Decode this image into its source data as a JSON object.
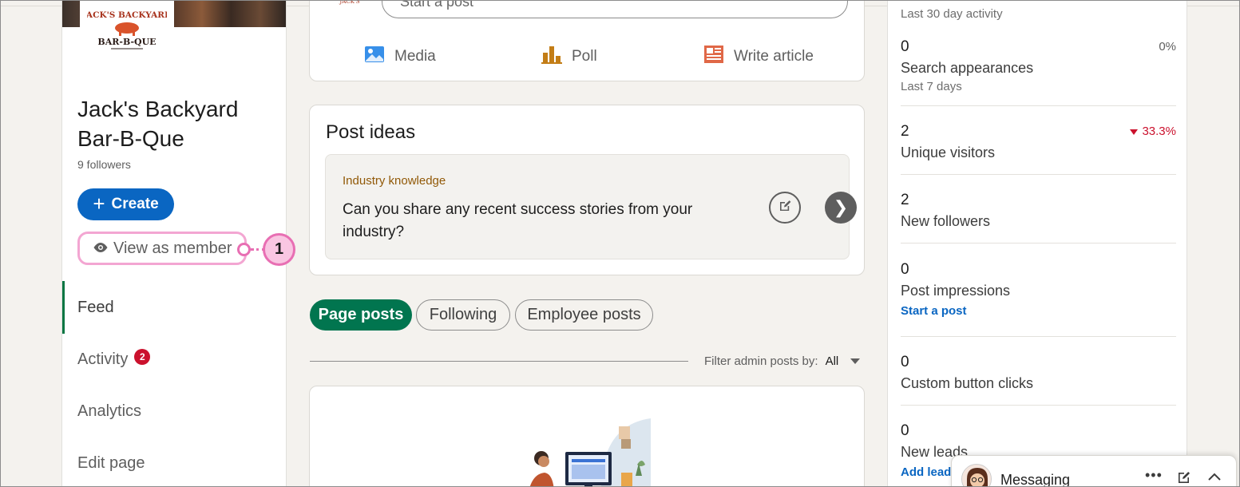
{
  "company": {
    "name": "Jack's Backyard Bar-B-Que",
    "followers": "9 followers",
    "logo_text_top": "JACK'S BACKYARD",
    "logo_text_bottom": "BAR-B-QUE"
  },
  "left": {
    "create_label": "Create",
    "view_member_label": "View as member",
    "nav": [
      {
        "label": "Feed",
        "active": true
      },
      {
        "label": "Activity",
        "badge": "2"
      },
      {
        "label": "Analytics"
      },
      {
        "label": "Edit page"
      }
    ]
  },
  "annotation": {
    "number": "1"
  },
  "compose": {
    "placeholder": "Start a post",
    "actions": [
      {
        "label": "Media",
        "icon": "media-icon"
      },
      {
        "label": "Poll",
        "icon": "poll-icon"
      },
      {
        "label": "Write article",
        "icon": "article-icon"
      }
    ]
  },
  "ideas": {
    "title": "Post ideas",
    "category": "Industry knowledge",
    "text": "Can you share any recent success stories from your industry?"
  },
  "feed_tabs": [
    "Page posts",
    "Following",
    "Employee posts"
  ],
  "filter": {
    "label": "Filter admin posts by:",
    "value": "All"
  },
  "analytics": {
    "subtitle": "Last 30 day activity",
    "stats": [
      {
        "num": "0",
        "label": "Search appearances",
        "sub": "Last 7 days",
        "pct": "0%"
      },
      {
        "num": "2",
        "label": "Unique visitors",
        "pct": "33.3%",
        "trend": "down"
      },
      {
        "num": "2",
        "label": "New followers"
      },
      {
        "num": "0",
        "label": "Post impressions",
        "link": "Start a post"
      },
      {
        "num": "0",
        "label": "Custom button clicks"
      },
      {
        "num": "0",
        "label": "New leads",
        "link": "Add lead"
      }
    ]
  },
  "messaging": {
    "title": "Messaging"
  },
  "colors": {
    "brand": "#0a66c2",
    "active_tab": "#01754f",
    "annotation": "#e86fb3",
    "badge": "#cb112d"
  }
}
